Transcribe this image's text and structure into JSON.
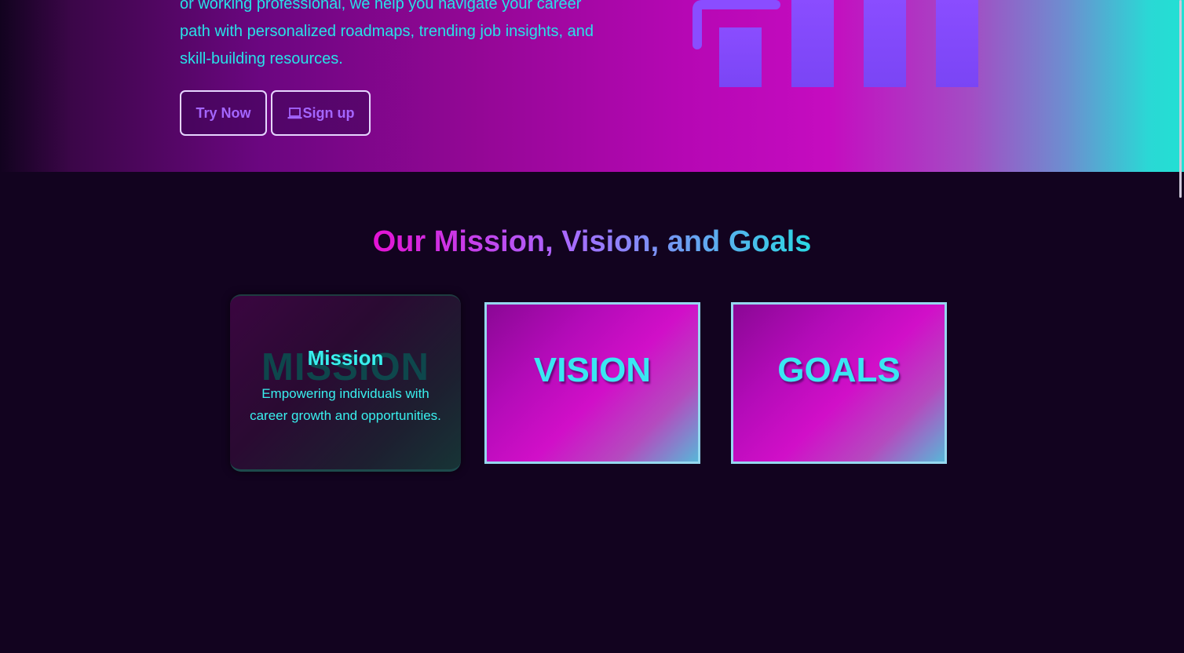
{
  "hero": {
    "paragraph": "or working professional, we help you navigate your career path with personalized roadmaps, trending job insights, and skill-building resources.",
    "try_now_label": "Try Now",
    "signup_label": "Sign up",
    "signup_icon": "laptop-icon",
    "illustration_icon": "bar-chart-icon"
  },
  "section": {
    "title": "Our Mission, Vision, and Goals"
  },
  "cards": {
    "mission": {
      "ghost_label": "MISSION",
      "title": "Mission",
      "text": "Empowering individuals with career growth and opportunities."
    },
    "vision": {
      "label": "VISION"
    },
    "goals": {
      "label": "GOALS"
    }
  },
  "colors": {
    "background": "#12031f",
    "accent_cyan": "#27e2e8",
    "accent_magenta": "#d10fc8",
    "button_text": "#a466ff"
  }
}
